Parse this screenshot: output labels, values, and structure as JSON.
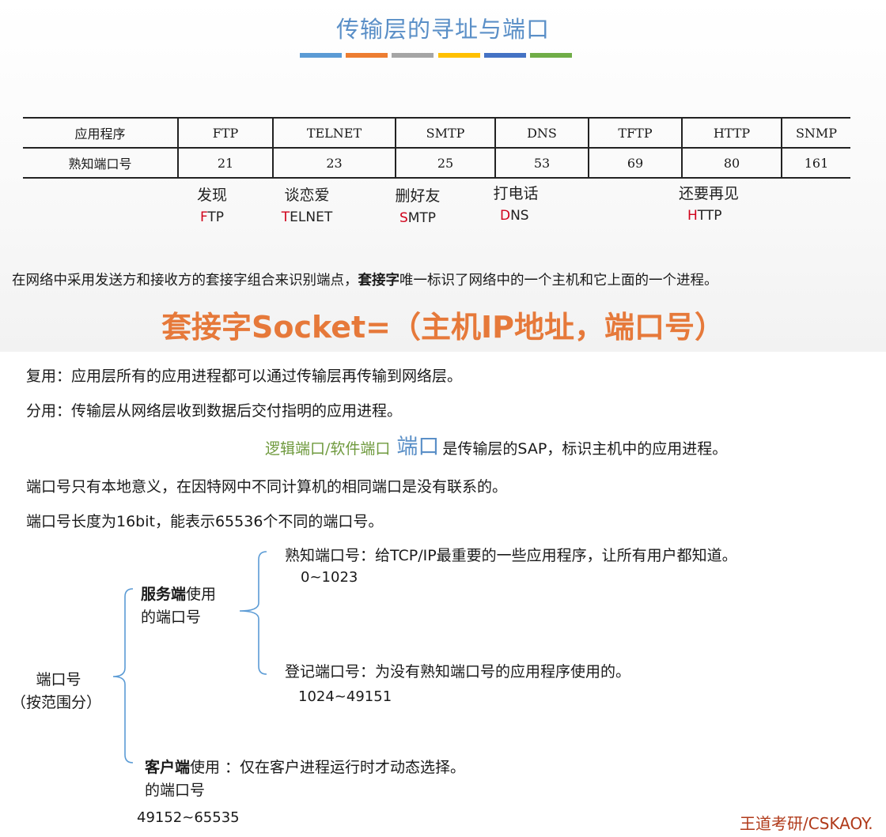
{
  "title": "传输层的寻址与端口",
  "accent_colors": [
    "#5b9bd5",
    "#ed7d31",
    "#a5a5a5",
    "#ffc000",
    "#4472c4",
    "#70ad47"
  ],
  "table": {
    "row1_header": "应用程序",
    "row2_header": "熟知端口号",
    "protocols": [
      "FTP",
      "TELNET",
      "SMTP",
      "DNS",
      "TFTP",
      "HTTP",
      "SNMP"
    ],
    "ports": [
      "21",
      "23",
      "25",
      "53",
      "69",
      "80",
      "161"
    ]
  },
  "mnemonics": [
    {
      "cn": "发现",
      "first": "F",
      "rest": "TP"
    },
    {
      "cn": "谈恋爱",
      "first": "T",
      "rest": "ELNET"
    },
    {
      "cn": "删好友",
      "first": "S",
      "rest": "MTP"
    },
    {
      "cn": "打电话",
      "first": "D",
      "rest": "NS"
    },
    {
      "cn": "还要再见",
      "first": "H",
      "rest": "TTP"
    }
  ],
  "socket": {
    "line_pre": "在网络中采用发送方和接收方的套接字组合来识别端点，",
    "line_bold": "套接字",
    "line_post": "唯一标识了网络中的一个主机和它上面的一个进程。",
    "formula": "套接字Socket=（主机IP地址，端口号）"
  },
  "reuse": "复用：应用层所有的应用进程都可以通过传输层再传输到网络层。",
  "demux": "分用：传输层从网络层收到数据后交付指明的应用进程。",
  "sap": {
    "alias": "逻辑端口/软件端口",
    "term": "端口",
    "desc": "是传输层的SAP，标识主机中的应用进程。"
  },
  "local_meaning": "端口号只有本地意义，在因特网中不同计算机的相同端口是没有联系的。",
  "length": "端口号长度为16bit，能表示65536个不同的端口号。",
  "tree": {
    "root_line1": "端口号",
    "root_line2": "（按范围分）",
    "server_bold": "服务端",
    "server_rest": "使用",
    "server_line2": "的端口号",
    "wellknown": "熟知端口号：给TCP/IP最重要的一些应用程序，让所有用户都知道。",
    "wellknown_range": "0~1023",
    "registered": "登记端口号：为没有熟知端口号的应用程序使用的。",
    "registered_range": "1024~49151",
    "client_bold": "客户端",
    "client_rest": "使用 ：仅在客户进程运行时才动态选择。",
    "client_line2": "的端口号",
    "client_range": "49152~65535"
  },
  "footer": "王道考研/CSKAOY."
}
